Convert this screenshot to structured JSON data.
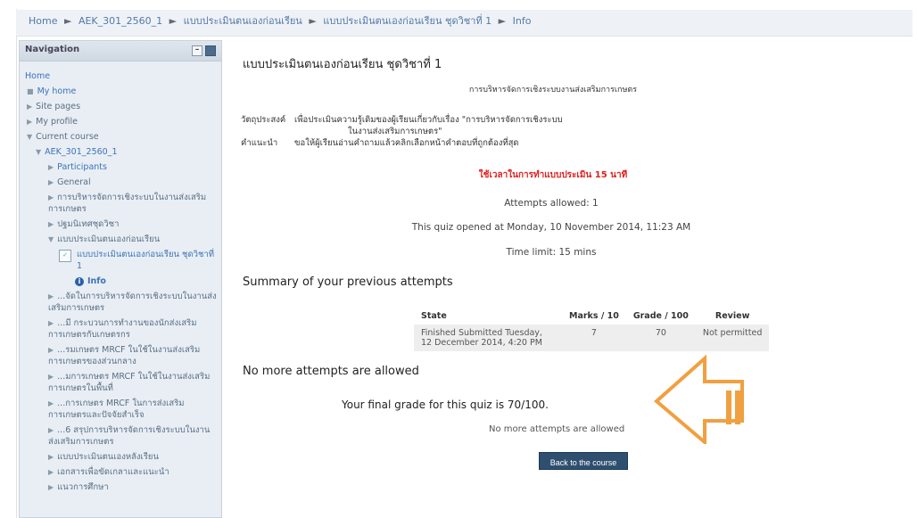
{
  "breadcrumb": {
    "items": [
      "Home",
      "AEK_301_2560_1",
      "แบบประเมินตนเองก่อนเรียน",
      "แบบประเมินตนเองก่อนเรียน ชุดวิชาที่ 1",
      "Info"
    ],
    "separator": "►"
  },
  "navigation": {
    "title": "Navigation",
    "home": "Home",
    "items": [
      {
        "label": "My home",
        "marker": "■"
      },
      {
        "label": "Site pages",
        "marker": "▶"
      },
      {
        "label": "My profile",
        "marker": "▶"
      },
      {
        "label": "Current course",
        "marker": "▼"
      }
    ],
    "course": {
      "label": "AEK_301_2560_1",
      "marker": "▼",
      "sections": [
        {
          "label": "Participants",
          "marker": "▶"
        },
        {
          "label": "General",
          "marker": "▶"
        },
        {
          "label": "การบริหารจัดการเชิงระบบในงานส่งเสริมการเกษตร",
          "marker": "▶"
        },
        {
          "label": "ปฐมนิเทศชุดวิชา",
          "marker": "▶"
        },
        {
          "label": "แบบประเมินตนเองก่อนเรียน",
          "marker": "▼"
        }
      ],
      "quiz_item": "แบบประเมินตนเองก่อนเรียน ชุดวิชาที่ 1",
      "info_item": "Info",
      "more": [
        {
          "label": "...จัดในการบริหารจัดการเชิงระบบในงานส่งเสริมการเกษตร",
          "marker": "▶"
        },
        {
          "label": "...มี กระบวนการทำงานของนักส่งเสริมการเกษตรกับเกษตรกร",
          "marker": "▶"
        },
        {
          "label": "...รมเกษตร MRCF ในใช้ในงานส่งเสริมการเกษตรของส่วนกลาง",
          "marker": "▶"
        },
        {
          "label": "...มการเกษตร MRCF ในใช้ในงานส่งเสริมการเกษตรในพื้นที่",
          "marker": "▶"
        },
        {
          "label": "...การเกษตร MRCF ในการส่งเสริมการเกษตรและปัจจัยสำเร็จ",
          "marker": "▶"
        },
        {
          "label": "...6 สรุปการบริหารจัดการเชิงระบบในงานส่งเสริมการเกษตร",
          "marker": "▶"
        },
        {
          "label": "แบบประเมินตนเองหลังเรียน",
          "marker": "▶"
        },
        {
          "label": "เอกสารเพื่อขัดเกลาและแนะนำ",
          "marker": "▶"
        },
        {
          "label": "แนวการศึกษา",
          "marker": "▶"
        }
      ]
    }
  },
  "main": {
    "title": "แบบประเมินตนเองก่อนเรียน ชุดวิชาที่ 1",
    "intro": {
      "heading": "การบริหารจัดการเชิงระบบงานส่งเสริมการเกษตร",
      "objective_label": "วัตถุประสงค์",
      "objective_text": "เพื่อประเมินความรู้เดิมของผู้เรียนเกี่ยวกับเรื่อง \"การบริหารจัดการเชิงระบบ",
      "objective_text2": "ในงานส่งเสริมการเกษตร\"",
      "instruction_label": "คำแนะนำ",
      "instruction_text": "ขอให้ผู้เรียนอ่านคำถามแล้วคลิกเลือกหน้าคำตอบที่ถูกต้องที่สุด",
      "time_note": "ใช้เวลาในการทำแบบประเมิน 15 นาที"
    },
    "attempts_allowed": "Attempts allowed: 1",
    "opened": "This quiz opened at Monday, 10 November 2014, 11:23 AM",
    "time_limit": "Time limit: 15 mins",
    "summary_title": "Summary of your previous attempts",
    "summary_table": {
      "headers": [
        "State",
        "Marks / 10",
        "Grade / 100",
        "Review"
      ],
      "rows": [
        {
          "state": "Finished",
          "submitted": "Submitted Tuesday, 12 December 2014, 4:20 PM",
          "marks": "7",
          "grade": "70",
          "review": "Not permitted"
        }
      ]
    },
    "no_more_heading": "No more attempts are allowed",
    "final_grade": "Your final grade for this quiz is 70/100.",
    "no_more_text": "No more attempts are allowed",
    "back_button": "Back to the course"
  },
  "colors": {
    "arrow": "#f0a040",
    "button": "#2e4f6f",
    "link": "#3d73b8",
    "warning": "#e02020"
  }
}
